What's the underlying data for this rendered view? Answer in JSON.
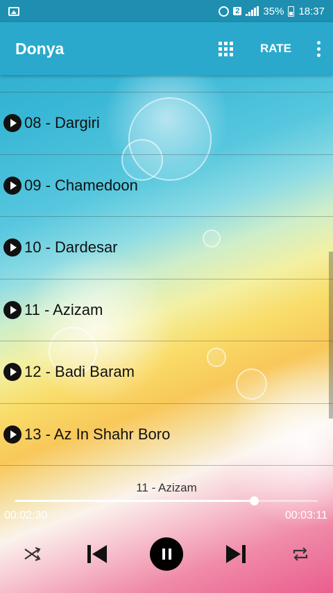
{
  "status_bar": {
    "sim_label": "2",
    "battery_percent": "35%",
    "time": "18:37",
    "icons": [
      "image-icon",
      "alarm-icon",
      "sim-icon",
      "signal-icon",
      "battery-icon"
    ]
  },
  "app_bar": {
    "title": "Donya",
    "rate_label": "RATE",
    "icons": [
      "grid-icon",
      "more-vert-icon"
    ]
  },
  "songs": [
    {
      "label": "08 - Dargiri"
    },
    {
      "label": "09 - Chamedoon"
    },
    {
      "label": "10 - Dardesar"
    },
    {
      "label": "11 - Azizam"
    },
    {
      "label": "12 - Badi Baram"
    },
    {
      "label": "13 - Az In Shahr Boro"
    }
  ],
  "player": {
    "now_playing": "11 - Azizam",
    "current_time": "00:02:30",
    "total_time": "00:03:11",
    "progress": 0.79,
    "controls": [
      "shuffle-icon",
      "previous-icon",
      "pause-icon",
      "next-icon",
      "repeat-icon"
    ]
  },
  "colors": {
    "status_bar": "#1e8fb0",
    "app_bar": "#2ba9cc"
  }
}
